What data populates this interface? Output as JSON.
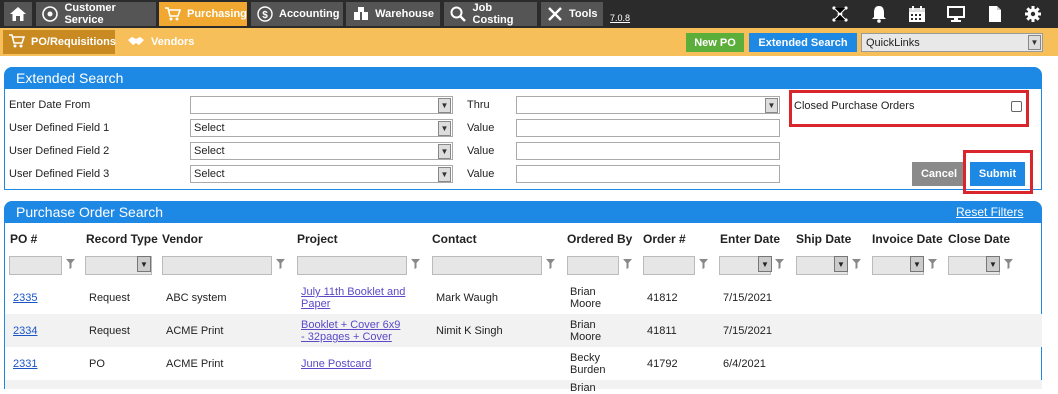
{
  "nav": {
    "tabs": [
      {
        "label": "Customer Service"
      },
      {
        "label": "Purchasing"
      },
      {
        "label": "Accounting"
      },
      {
        "label": "Warehouse"
      },
      {
        "label": "Job Costing"
      },
      {
        "label": "Tools"
      }
    ],
    "version": "7.0.8"
  },
  "subnav": {
    "tabs": [
      {
        "label": "PO/Requisitions"
      },
      {
        "label": "Vendors"
      }
    ],
    "new_po": "New PO",
    "extended_search": "Extended Search",
    "quicklinks": "QuickLinks"
  },
  "extended_search": {
    "title": "Extended Search",
    "enter_date_from": "Enter Date From",
    "thru": "Thru",
    "closed_po": "Closed Purchase Orders",
    "udf1": "User Defined Field 1",
    "udf2": "User Defined Field 2",
    "udf3": "User Defined Field 3",
    "select": "Select",
    "value": "Value",
    "cancel": "Cancel",
    "submit": "Submit"
  },
  "po_search": {
    "title": "Purchase Order Search",
    "reset": "Reset Filters",
    "headers": [
      "PO #",
      "Record Type",
      "Vendor",
      "Project",
      "Contact",
      "Ordered By",
      "Order #",
      "Enter Date",
      "Ship Date",
      "Invoice Date",
      "Close Date"
    ],
    "rows": [
      {
        "po": "2335",
        "type": "Request",
        "vendor": "ABC system",
        "project_1": "July 11th Booklet and",
        "project_2": "Paper",
        "contact": "Mark Waugh",
        "ob_1": "Brian",
        "ob_2": "Moore",
        "order": "41812",
        "date": "7/15/2021"
      },
      {
        "po": "2334",
        "type": "Request",
        "vendor": "ACME Print",
        "project_1": "Booklet + Cover 6x9",
        "project_2": "- 32pages + Cover",
        "contact": "Nimit K Singh",
        "ob_1": "Brian",
        "ob_2": "Moore",
        "order": "41811",
        "date": "7/15/2021"
      },
      {
        "po": "2331",
        "type": "PO",
        "vendor": "ACME Print",
        "project_1": "June Postcard",
        "project_2": "",
        "contact": "",
        "ob_1": "Becky",
        "ob_2": "Burden",
        "order": "41792",
        "date": "6/4/2021"
      },
      {
        "ob_1": "Brian"
      }
    ]
  }
}
